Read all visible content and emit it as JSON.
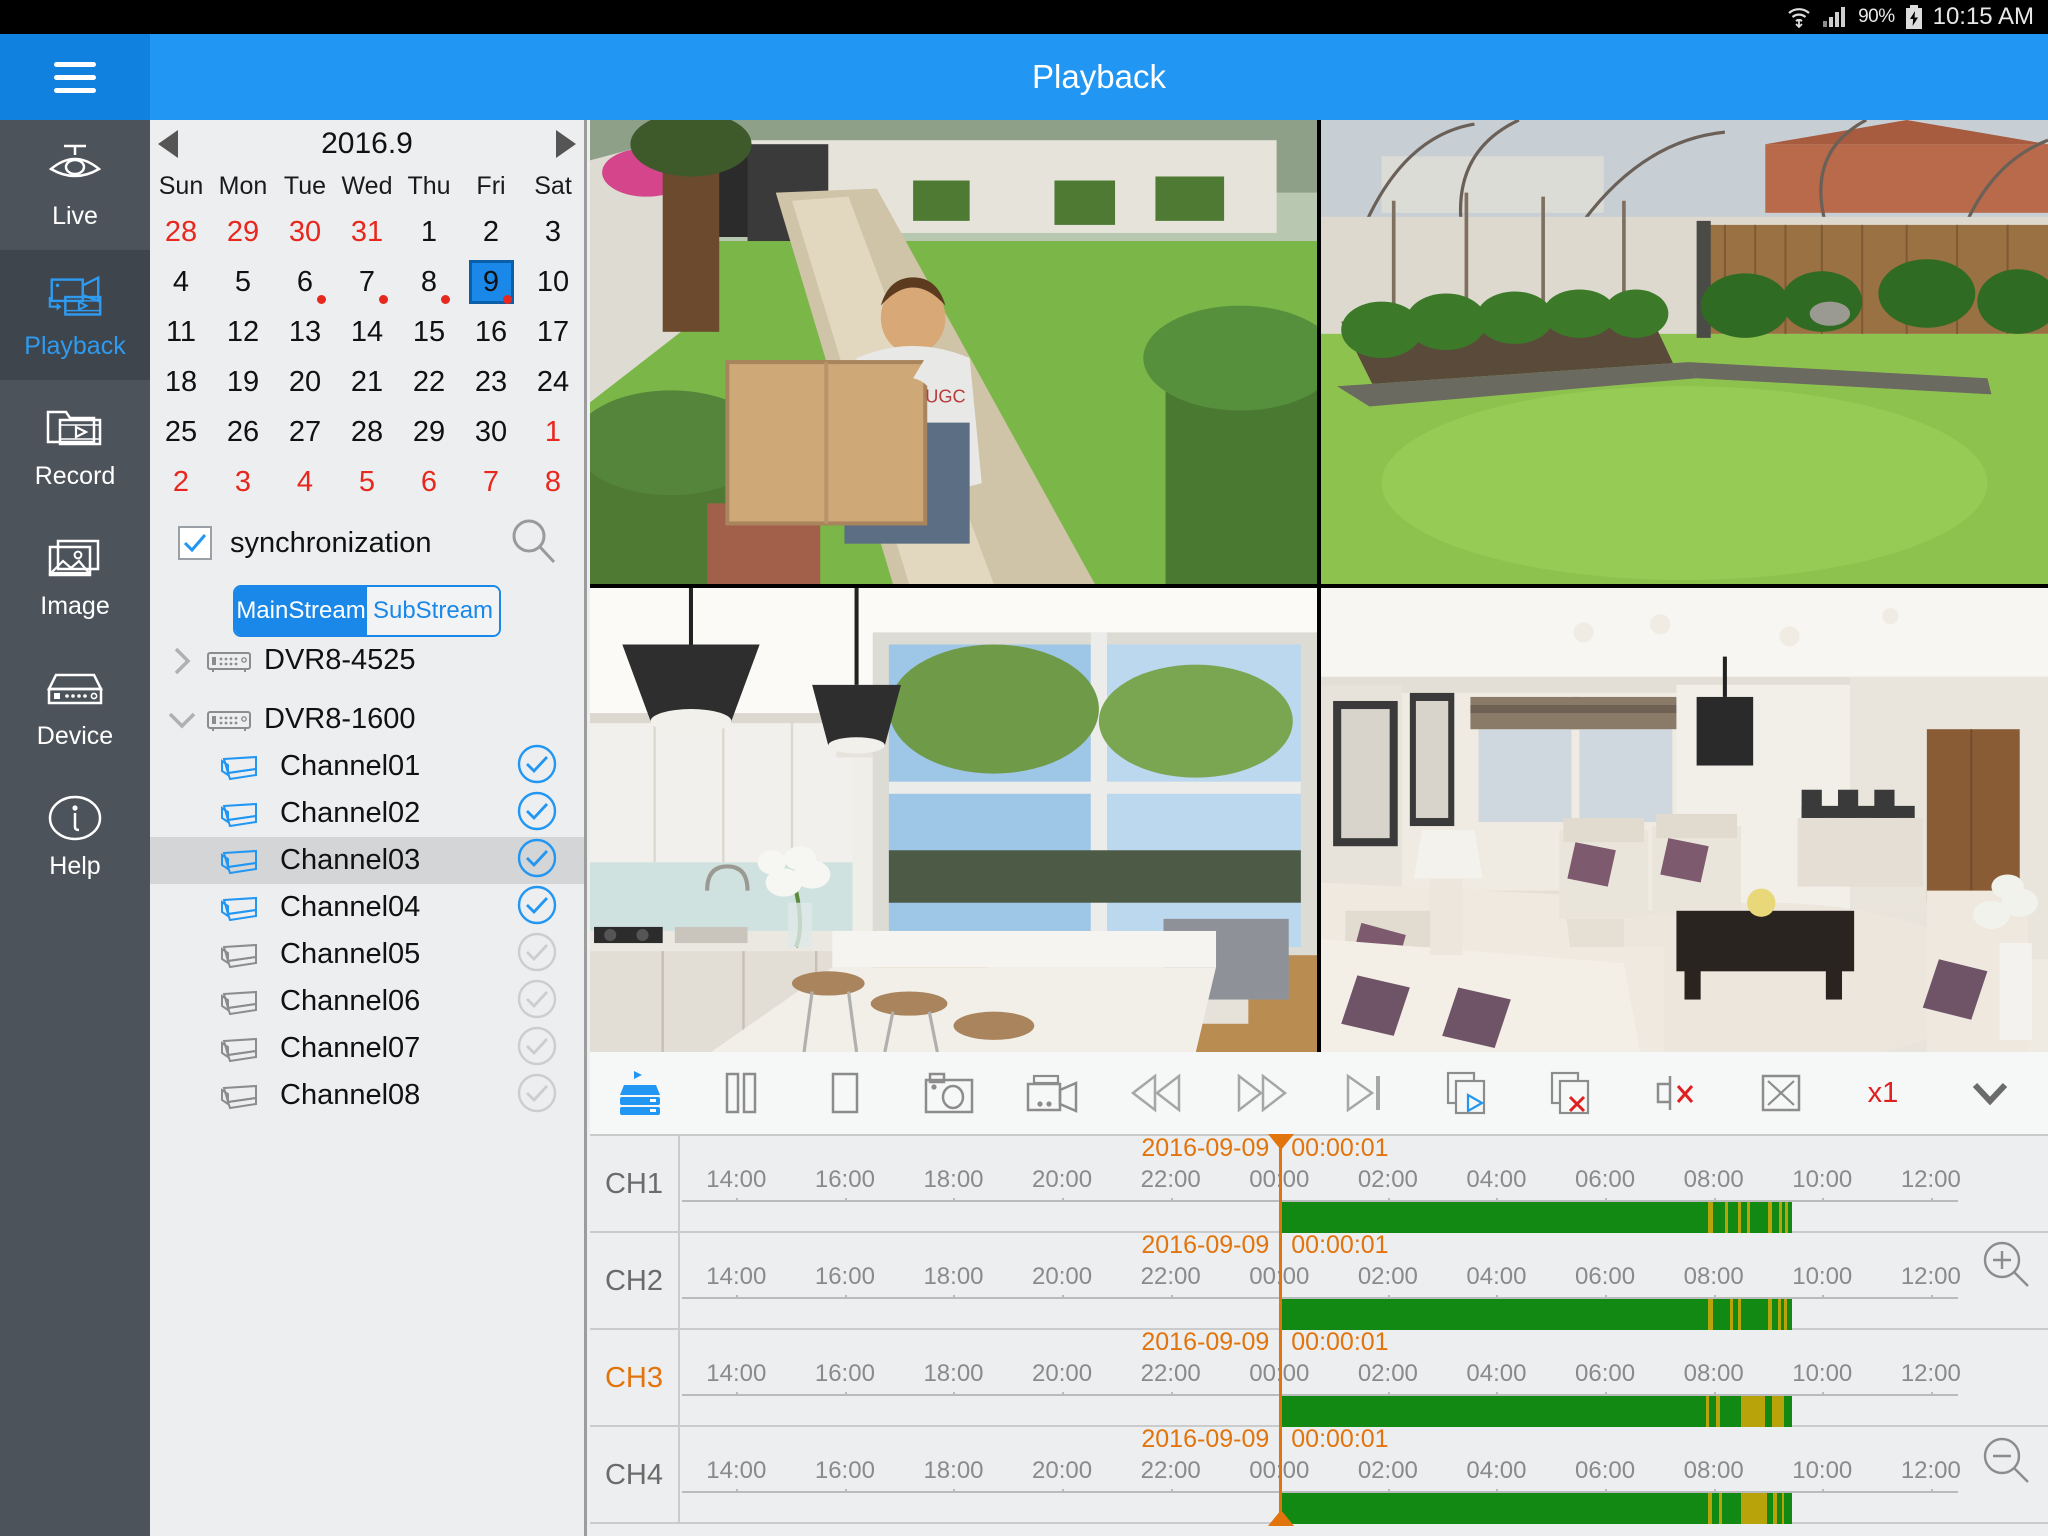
{
  "statusbar": {
    "battery_pct": "90%",
    "clock": "10:15 AM",
    "icons": [
      "wifi-icon",
      "signal-icon",
      "battery-charging-icon"
    ]
  },
  "header": {
    "title": "Playback",
    "menu_icon": "hamburger-icon",
    "accent": "#2196f3"
  },
  "nav": {
    "items": [
      {
        "label": "Live",
        "icon": "dome-camera-icon",
        "selected": false
      },
      {
        "label": "Playback",
        "icon": "playback-film-icon",
        "selected": true
      },
      {
        "label": "Record",
        "icon": "folder-film-icon",
        "selected": false
      },
      {
        "label": "Image",
        "icon": "picture-icon",
        "selected": false
      },
      {
        "label": "Device",
        "icon": "dvr-box-icon",
        "selected": false
      },
      {
        "label": "Help",
        "icon": "info-circle-icon",
        "selected": false
      }
    ]
  },
  "calendar": {
    "title": "2016.9",
    "prev_icon": "left-triangle-icon",
    "next_icon": "right-triangle-icon",
    "dow": [
      "Sun",
      "Mon",
      "Tue",
      "Wed",
      "Thu",
      "Fri",
      "Sat"
    ],
    "weeks": [
      [
        {
          "d": "28",
          "o": true
        },
        {
          "d": "29",
          "o": true
        },
        {
          "d": "30",
          "o": true
        },
        {
          "d": "31",
          "o": true
        },
        {
          "d": "1"
        },
        {
          "d": "2"
        },
        {
          "d": "3"
        }
      ],
      [
        {
          "d": "4"
        },
        {
          "d": "5"
        },
        {
          "d": "6",
          "dot": true
        },
        {
          "d": "7",
          "dot": true
        },
        {
          "d": "8",
          "dot": true
        },
        {
          "d": "9",
          "dot": true,
          "sel": true
        },
        {
          "d": "10"
        }
      ],
      [
        {
          "d": "11"
        },
        {
          "d": "12"
        },
        {
          "d": "13"
        },
        {
          "d": "14"
        },
        {
          "d": "15"
        },
        {
          "d": "16"
        },
        {
          "d": "17"
        }
      ],
      [
        {
          "d": "18"
        },
        {
          "d": "19"
        },
        {
          "d": "20"
        },
        {
          "d": "21"
        },
        {
          "d": "22"
        },
        {
          "d": "23"
        },
        {
          "d": "24"
        }
      ],
      [
        {
          "d": "25"
        },
        {
          "d": "26"
        },
        {
          "d": "27"
        },
        {
          "d": "28"
        },
        {
          "d": "29"
        },
        {
          "d": "30"
        },
        {
          "d": "1",
          "o": true
        }
      ],
      [
        {
          "d": "2",
          "o": true
        },
        {
          "d": "3",
          "o": true
        },
        {
          "d": "4",
          "o": true
        },
        {
          "d": "5",
          "o": true
        },
        {
          "d": "6",
          "o": true
        },
        {
          "d": "7",
          "o": true
        },
        {
          "d": "8",
          "o": true
        }
      ]
    ]
  },
  "sidebar": {
    "sync_label": "synchronization",
    "sync_checked": true,
    "search_icon": "search-icon",
    "stream": {
      "main": "MainStream",
      "sub": "SubStream",
      "selected": "MainStream"
    },
    "devices": [
      {
        "name": "DVR8-4525",
        "expanded": false,
        "icon": "dvr-box-icon",
        "chevron": "chevron-right-icon"
      },
      {
        "name": "DVR8-1600",
        "expanded": true,
        "icon": "dvr-box-icon",
        "chevron": "chevron-down-icon"
      }
    ],
    "channels": [
      {
        "name": "Channel01",
        "checked": true,
        "highlighted": false
      },
      {
        "name": "Channel02",
        "checked": true,
        "highlighted": false
      },
      {
        "name": "Channel03",
        "checked": true,
        "highlighted": true
      },
      {
        "name": "Channel04",
        "checked": true,
        "highlighted": false
      },
      {
        "name": "Channel05",
        "checked": false,
        "highlighted": false
      },
      {
        "name": "Channel06",
        "checked": false,
        "highlighted": false
      },
      {
        "name": "Channel07",
        "checked": false,
        "highlighted": false
      },
      {
        "name": "Channel08",
        "checked": false,
        "highlighted": false
      }
    ]
  },
  "videos": [
    {
      "name": "front-yard-delivery",
      "description": "Man carrying cardboard box on garden path"
    },
    {
      "name": "back-garden",
      "description": "Backyard lawn with garden bed and fence"
    },
    {
      "name": "kitchen",
      "description": "White kitchen with pendant lamps and stools"
    },
    {
      "name": "living-room",
      "description": "Living room with sofas and coffee table"
    }
  ],
  "toolbar": {
    "buttons": [
      {
        "name": "device-stream-button",
        "icon": "dvr-stack-icon",
        "label": ""
      },
      {
        "name": "pause-button",
        "icon": "pause-icon",
        "label": ""
      },
      {
        "name": "stop-button",
        "icon": "stop-icon",
        "label": ""
      },
      {
        "name": "snapshot-button",
        "icon": "camera-icon",
        "label": ""
      },
      {
        "name": "record-button",
        "icon": "video-record-icon",
        "label": ""
      },
      {
        "name": "rewind-button",
        "icon": "rewind-icon",
        "label": ""
      },
      {
        "name": "fast-forward-button",
        "icon": "fast-forward-icon",
        "label": ""
      },
      {
        "name": "next-frame-button",
        "icon": "next-frame-icon",
        "label": ""
      },
      {
        "name": "play-all-button",
        "icon": "play-all-icon",
        "label": ""
      },
      {
        "name": "stop-all-button",
        "icon": "stop-all-icon",
        "label": ""
      },
      {
        "name": "mute-button",
        "icon": "mute-icon",
        "label": ""
      },
      {
        "name": "fullscreen-button",
        "icon": "fullscreen-icon",
        "label": ""
      }
    ],
    "speed_label": "x1",
    "speed_color": "#e02020",
    "collapse_icon": "chevron-down-icon"
  },
  "timeline": {
    "zoom_in_icon": "zoom-in-icon",
    "zoom_out_icon": "zoom-out-icon",
    "ticks": [
      "14:00",
      "16:00",
      "18:00",
      "20:00",
      "22:00",
      "00:00",
      "02:00",
      "04:00",
      "06:00",
      "08:00",
      "10:00",
      "12:00"
    ],
    "rows": [
      {
        "channel": "CH1",
        "active": false,
        "date": "2016-09-09",
        "time": "00:00:01",
        "bar_start_h": 24.0,
        "bar_end_h": 33.45,
        "stripes": [
          [
            31.9,
            0.09
          ],
          [
            32.2,
            0.06
          ],
          [
            32.45,
            0.05
          ],
          [
            32.62,
            0.05
          ],
          [
            33.0,
            0.07
          ],
          [
            33.2,
            0.05
          ],
          [
            33.32,
            0.05
          ]
        ]
      },
      {
        "channel": "CH2",
        "active": false,
        "date": "2016-09-09",
        "time": "00:00:01",
        "bar_start_h": 24.0,
        "bar_end_h": 33.45,
        "stripes": [
          [
            31.9,
            0.09
          ],
          [
            32.3,
            0.05
          ],
          [
            32.45,
            0.05
          ],
          [
            33.0,
            0.07
          ],
          [
            33.18,
            0.06
          ],
          [
            33.3,
            0.05
          ]
        ]
      },
      {
        "channel": "CH3",
        "active": true,
        "date": "2016-09-09",
        "time": "00:00:01",
        "bar_start_h": 24.0,
        "bar_end_h": 33.45,
        "stripes": [
          [
            31.85,
            0.07
          ],
          [
            32.05,
            0.06
          ],
          [
            32.5,
            0.45
          ],
          [
            33.08,
            0.22
          ]
        ]
      },
      {
        "channel": "CH4",
        "active": false,
        "date": "2016-09-09",
        "time": "00:00:01",
        "bar_start_h": 24.0,
        "bar_end_h": 33.45,
        "stripes": [
          [
            31.9,
            0.07
          ],
          [
            32.1,
            0.05
          ],
          [
            32.5,
            0.48
          ],
          [
            33.1,
            0.06
          ],
          [
            33.25,
            0.05
          ]
        ]
      }
    ],
    "playhead_h": 24.0,
    "axis_start_h": 13.0,
    "axis_end_h": 36.5,
    "colors": {
      "recording": "#128912",
      "alarm": "#b8a30b",
      "playhead": "#e2740d"
    }
  }
}
